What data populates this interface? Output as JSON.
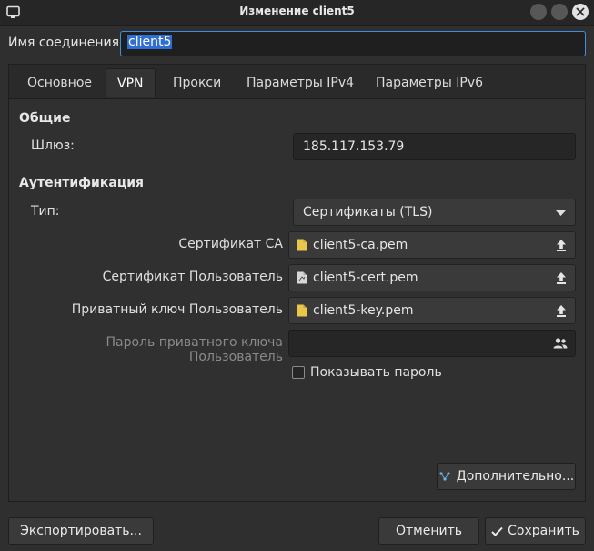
{
  "window": {
    "title": "Изменение client5"
  },
  "connection": {
    "label": "Имя соединения",
    "value": "client5"
  },
  "tabs": [
    {
      "label": "Основное"
    },
    {
      "label": "VPN",
      "active": true
    },
    {
      "label": "Прокси"
    },
    {
      "label": "Параметры IPv4"
    },
    {
      "label": "Параметры IPv6"
    }
  ],
  "general": {
    "title": "Общие",
    "gateway_label": "Шлюз:",
    "gateway_value": "185.117.153.79"
  },
  "auth": {
    "title": "Аутентификация",
    "type_label": "Тип:",
    "type_value": "Сертификаты (TLS)",
    "ca_label": "Сертификат CA",
    "ca_file": "client5-ca.pem",
    "user_cert_label": "Сертификат Пользователь",
    "user_cert_file": "client5-cert.pem",
    "key_label": "Приватный ключ Пользователь",
    "key_file": "client5-key.pem",
    "key_password_label": "Пароль приватного ключа Пользователь",
    "key_password_value": "",
    "show_password_label": "Показывать пароль",
    "show_password_checked": false
  },
  "buttons": {
    "advanced": "Дополнительно...",
    "export": "Экспортировать...",
    "cancel": "Отменить",
    "save": "Сохранить"
  },
  "colors": {
    "focus": "#3d8fe0",
    "selection": "#2f6fd1",
    "file_icon": "#e8c74a"
  }
}
